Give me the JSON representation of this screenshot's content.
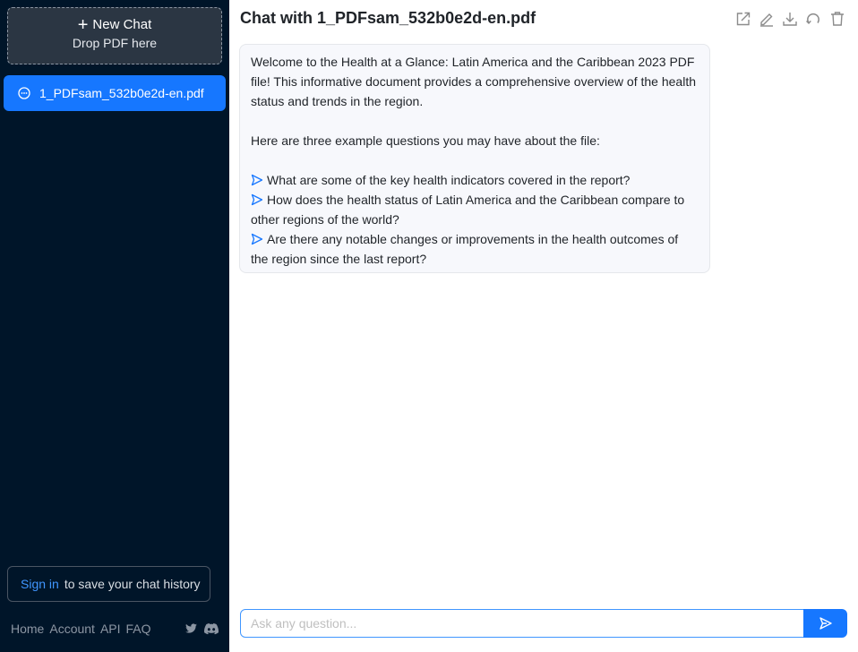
{
  "sidebar": {
    "new_chat_label": "New Chat",
    "drop_label": "Drop PDF here",
    "chats": [
      {
        "label": "1_PDFsam_532b0e2d-en.pdf",
        "active": true
      }
    ],
    "signin_link": "Sign in",
    "signin_suffix": "to save your chat history",
    "footer_links": [
      "Home",
      "Account",
      "API",
      "FAQ"
    ],
    "social_icons": [
      "twitter-icon",
      "discord-icon"
    ]
  },
  "header": {
    "title": "Chat with 1_PDFsam_532b0e2d-en.pdf",
    "toolbar_icons": [
      "share-icon",
      "edit-icon",
      "download-icon",
      "refresh-icon",
      "trash-icon"
    ]
  },
  "message": {
    "intro": "Welcome to the Health at a Glance: Latin America and the Caribbean 2023 PDF file! This informative document provides a comprehensive overview of the health status and trends in the region.",
    "lead": "Here are three example questions you may have about the file:",
    "questions": [
      "What are some of the key health indicators covered in the report?",
      "How does the health status of Latin America and the Caribbean compare to other regions of the world?",
      "Are there any notable changes or improvements in the health outcomes of the region since the last report?"
    ]
  },
  "input": {
    "placeholder": "Ask any question...",
    "value": ""
  },
  "colors": {
    "sidebar_bg": "#001529",
    "accent": "#1677ff",
    "bubble_bg": "#f7f8fc"
  }
}
